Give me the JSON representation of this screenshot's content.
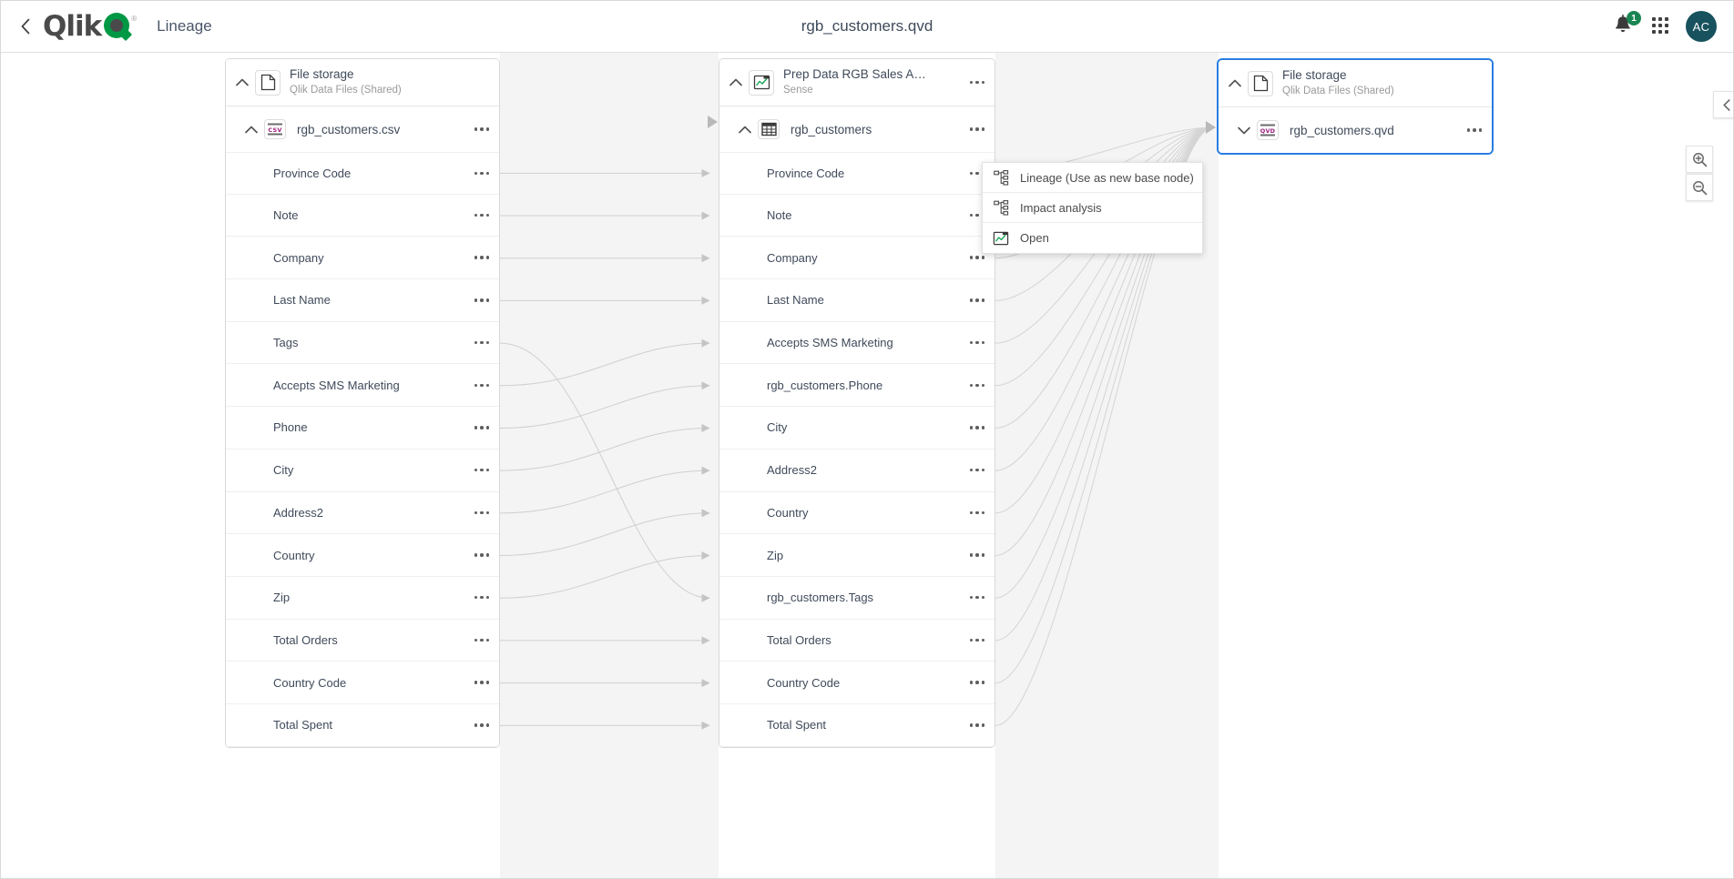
{
  "header": {
    "back_icon": "chevron-left-icon",
    "brand": "Qlik",
    "brand_registered": "®",
    "section": "Lineage",
    "title": "rgb_customers.qvd",
    "notification_count": "1",
    "bell_icon": "bell-icon",
    "apps_icon": "grid-apps-icon",
    "avatar_initials": "AC"
  },
  "nodes": [
    {
      "id": "left",
      "title": "File storage",
      "subtitle": "Qlik Data Files (Shared)",
      "icon": "file-icon",
      "expanded": true,
      "selected": false,
      "dataset": {
        "name": "rgb_customers.csv",
        "icon": "csv-file-icon",
        "expanded": true,
        "kebab": "more-options-icon"
      },
      "fields": [
        "Province Code",
        "Note",
        "Company",
        "Last Name",
        "Tags",
        "Accepts SMS Marketing",
        "Phone",
        "City",
        "Address2",
        "Country",
        "Zip",
        "Total Orders",
        "Country Code",
        "Total Spent"
      ]
    },
    {
      "id": "middle",
      "title": "Prep Data RGB Sales A…",
      "subtitle": "Sense",
      "icon": "sense-app-icon",
      "expanded": true,
      "selected": false,
      "dataset": {
        "name": "rgb_customers",
        "icon": "table-icon",
        "expanded": true,
        "kebab": "more-options-icon"
      },
      "fields": [
        "Province Code",
        "Note",
        "Company",
        "Last Name",
        "Accepts SMS Marketing",
        "rgb_customers.Phone",
        "City",
        "Address2",
        "Country",
        "Zip",
        "rgb_customers.Tags",
        "Total Orders",
        "Country Code",
        "Total Spent"
      ]
    },
    {
      "id": "right",
      "title": "File storage",
      "subtitle": "Qlik Data Files (Shared)",
      "icon": "file-icon",
      "expanded": true,
      "selected": true,
      "dataset": {
        "name": "rgb_customers.qvd",
        "icon": "qvd-file-icon",
        "expanded": false,
        "kebab": "more-options-icon"
      },
      "fields": []
    }
  ],
  "context_menu": {
    "visible": true,
    "items": [
      {
        "label": "Lineage (Use as new base node)",
        "icon": "lineage-icon"
      },
      {
        "label": "Impact analysis",
        "icon": "impact-analysis-icon"
      },
      {
        "label": "Open",
        "icon": "open-app-icon"
      }
    ]
  },
  "nav_controls": {
    "up": "arrow-up-icon",
    "down": "arrow-down-icon",
    "left": "arrow-left-icon",
    "right": "arrow-right-icon",
    "home": "home-icon",
    "zoom_in": "zoom-in-icon",
    "zoom_out": "zoom-out-icon"
  },
  "colors": {
    "brand_green": "#009845",
    "accent_blue": "#2a7de1",
    "avatar_bg": "#17525e",
    "badge_green": "#1a8553",
    "band_gray": "#f4f4f4",
    "edge_gray": "#c8c8c8",
    "csv_purple": "#9c1f7e",
    "text_primary": "#3f4a5a",
    "text_muted": "#9a9a9a"
  }
}
